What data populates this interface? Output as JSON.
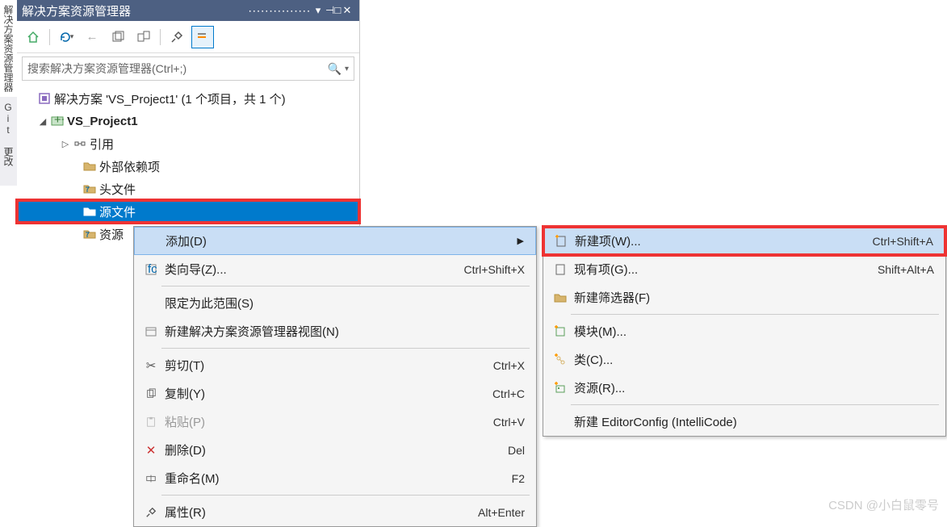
{
  "vtabs": {
    "solution": "解决方案资源管理器",
    "git": "Git 更改"
  },
  "panel": {
    "title": "解决方案资源管理器",
    "search_placeholder": "搜索解决方案资源管理器(Ctrl+;)"
  },
  "tree": {
    "solution": "解决方案 'VS_Project1' (1 个项目，共 1 个)",
    "project": "VS_Project1",
    "references": "引用",
    "external_deps": "外部依赖项",
    "header_files": "头文件",
    "source_files": "源文件",
    "resource_files": "资源"
  },
  "context_menu": {
    "add": "添加(D)",
    "class_wizard": {
      "label": "类向导(Z)...",
      "shortcut": "Ctrl+Shift+X"
    },
    "scope": "限定为此范围(S)",
    "new_view": "新建解决方案资源管理器视图(N)",
    "cut": {
      "label": "剪切(T)",
      "shortcut": "Ctrl+X"
    },
    "copy": {
      "label": "复制(Y)",
      "shortcut": "Ctrl+C"
    },
    "paste": {
      "label": "粘贴(P)",
      "shortcut": "Ctrl+V"
    },
    "delete": {
      "label": "删除(D)",
      "shortcut": "Del"
    },
    "rename": {
      "label": "重命名(M)",
      "shortcut": "F2"
    },
    "properties": {
      "label": "属性(R)",
      "shortcut": "Alt+Enter"
    }
  },
  "submenu": {
    "new_item": {
      "label": "新建项(W)...",
      "shortcut": "Ctrl+Shift+A"
    },
    "existing_item": {
      "label": "现有项(G)...",
      "shortcut": "Shift+Alt+A"
    },
    "new_filter": "新建筛选器(F)",
    "module": "模块(M)...",
    "class": "类(C)...",
    "resource": "资源(R)...",
    "editorconfig": "新建 EditorConfig (IntelliCode)"
  },
  "watermark": "CSDN @小白鼠零号"
}
